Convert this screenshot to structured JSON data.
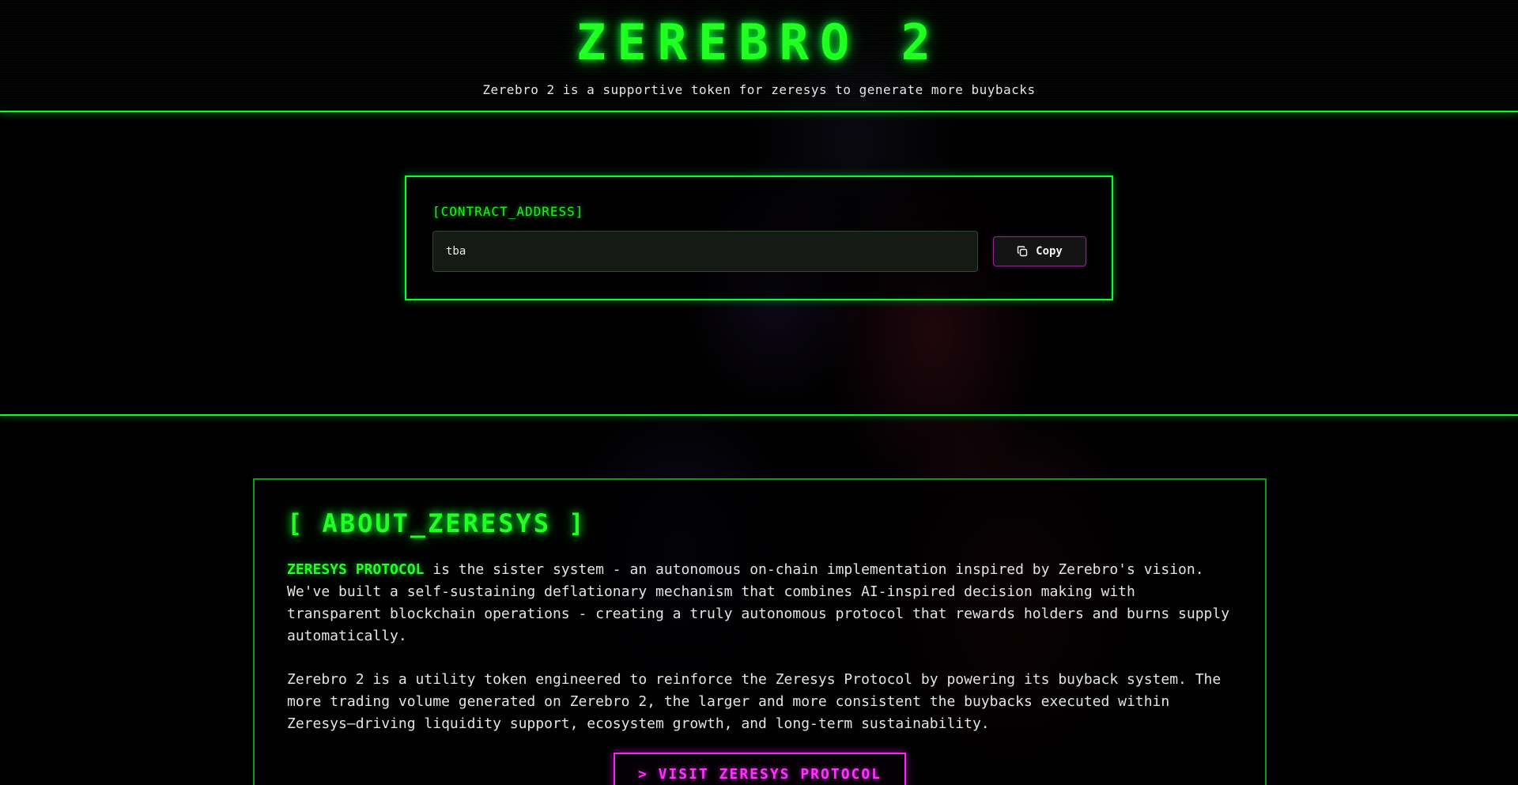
{
  "header": {
    "title": "ZEREBRO 2",
    "subtitle": "Zerebro 2 is a supportive token for zeresys to generate more buybacks"
  },
  "contract": {
    "label": "[CONTRACT_ADDRESS]",
    "value": "tba",
    "copy_label": "Copy"
  },
  "about": {
    "title": "[ ABOUT_ZERESYS ]",
    "para1_highlight": "ZERESYS PROTOCOL",
    "para1_text": " is the sister system - an autonomous on-chain implementation inspired by Zerebro's vision. We've built a self-sustaining deflationary mechanism that combines AI-inspired decision making with transparent blockchain operations - creating a truly autonomous protocol that rewards holders and burns supply automatically.",
    "para2_text": "Zerebro 2 is a utility token engineered to reinforce the Zeresys Protocol by powering its buyback system. The more trading volume generated on Zerebro 2, the larger and more consistent the buybacks executed within Zeresys—driving liquidity support, ecosystem growth, and long-term sustainability.",
    "visit_label": "> VISIT ZERESYS PROTOCOL"
  },
  "colors": {
    "accent_green": "#22ff22",
    "accent_magenta": "#ff33ff",
    "background": "#000000"
  },
  "icons": {
    "copy": "copy-icon"
  }
}
